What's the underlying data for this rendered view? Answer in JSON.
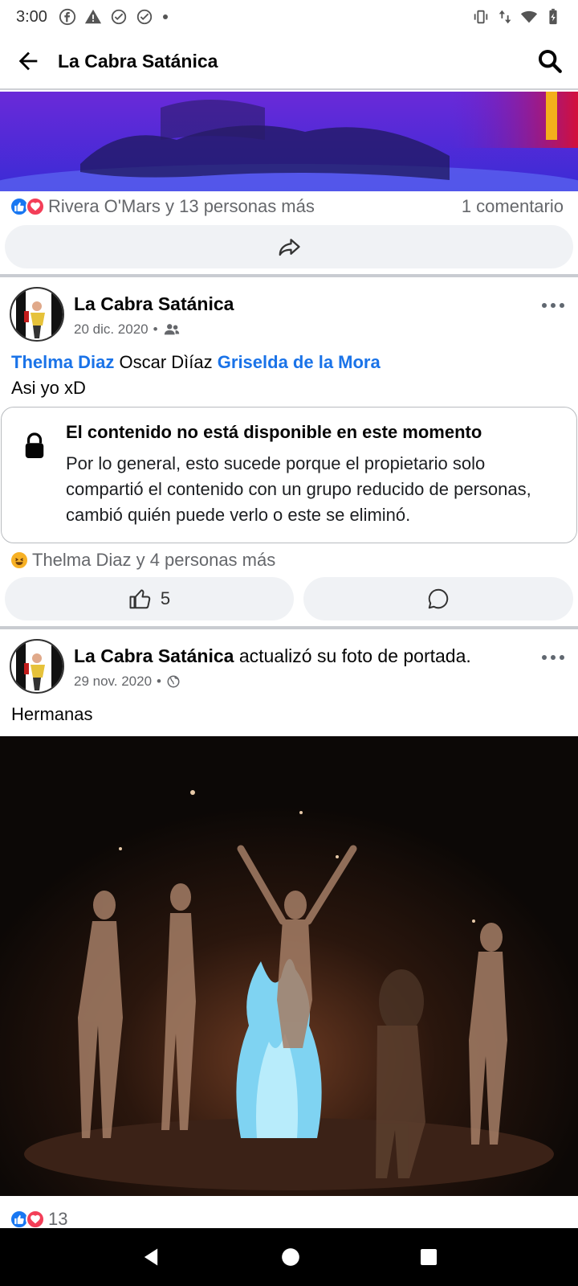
{
  "status": {
    "time": "3:00"
  },
  "appbar": {
    "title": "La Cabra Satánica"
  },
  "post1": {
    "reaction_text": "Rivera O'Mars y 13 personas más",
    "comment_count": "1 comentario"
  },
  "post2": {
    "author": "La Cabra Satánica",
    "date": "20 dic. 2020",
    "meta_sep": "•",
    "tags": [
      "Thelma Diaz",
      "Oscar Dìíaz",
      "Griselda de la Mora"
    ],
    "text": "Asi yo xD",
    "unavailable_title": "El contenido no está disponible en este momento",
    "unavailable_desc": "Por lo general, esto sucede porque el propietario solo compartió el contenido con un grupo reducido de personas, cambió quién puede verlo o este se eliminó.",
    "reaction_text": "Thelma Diaz y 4 personas más",
    "like_count": "5"
  },
  "post3": {
    "author": "La Cabra Satánica",
    "action": "actualizó su foto de portada.",
    "date": "29 nov. 2020",
    "meta_sep": "•",
    "text": "Hermanas",
    "reaction_count": "13"
  },
  "colors": {
    "link": "#1a73e8",
    "like": "#1877f2",
    "love": "#f33e58"
  }
}
